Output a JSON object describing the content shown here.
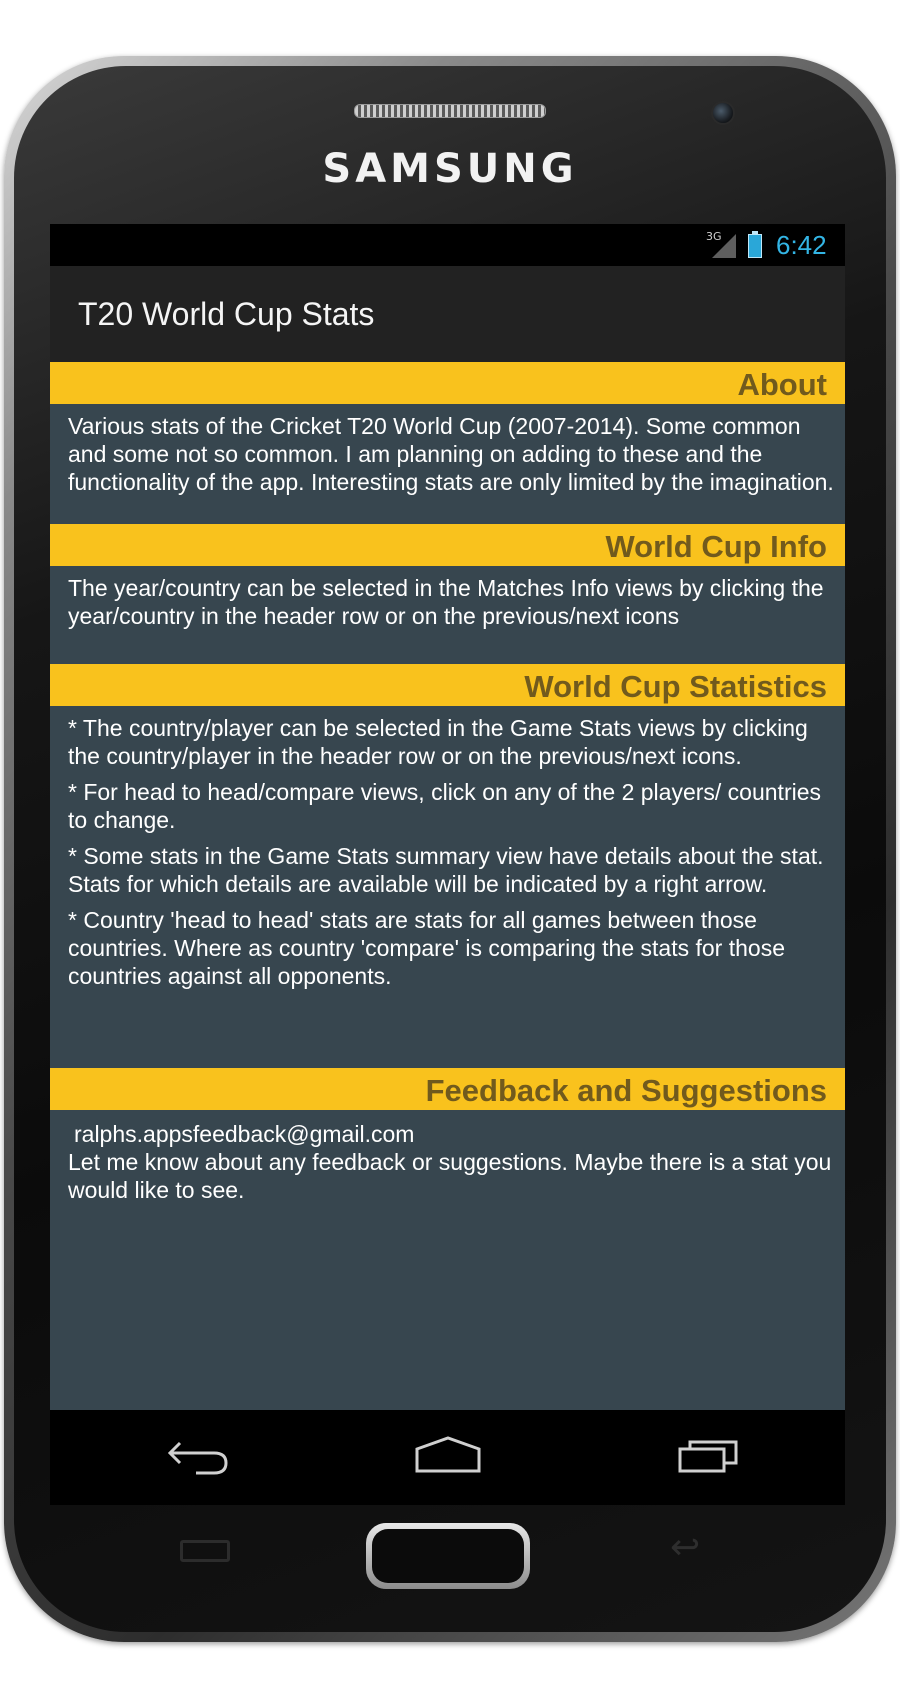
{
  "device": {
    "brand": "SAMSUNG"
  },
  "status_bar": {
    "network": "3G",
    "time": "6:42",
    "time_color": "#33b5e5"
  },
  "action_bar": {
    "title": "T20 World Cup Stats"
  },
  "colors": {
    "header_bg": "#f9c21d",
    "header_text": "#715a1d",
    "content_bg": "#37464f"
  },
  "sections": {
    "about": {
      "heading": "About",
      "body": "Various stats of the Cricket T20 World Cup (2007-2014). Some common and some not so common. I am planning on adding to these and the functionality of the app. Interesting stats are only limited by the imagination."
    },
    "world_cup_info": {
      "heading": "World Cup Info",
      "body": "The year/country can be selected in the Matches Info views by clicking the year/country in the header row or on the previous/next icons"
    },
    "world_cup_statistics": {
      "heading": "World Cup Statistics",
      "items": [
        "* The country/player can be selected in the Game Stats views by clicking the country/player in the header row or on the previous/next icons.",
        "* For head to head/compare views, click on any of the 2 players/ countries to change.",
        " * Some stats in the Game Stats summary view have details about the stat. Stats for which details are available will be indicated by a right arrow.",
        " * Country 'head to head' stats are stats for all games between those countries. Where as country 'compare' is comparing the stats for those countries against all opponents."
      ]
    },
    "feedback": {
      "heading": "Feedback and Suggestions",
      "email": "ralphs.appsfeedback@gmail.com",
      "body": " Let me know about any feedback or suggestions. Maybe there is a stat you would like to see."
    }
  },
  "nav_bar": {
    "back_icon": "back-arrow-icon",
    "home_icon": "home-icon",
    "recent_icon": "recent-apps-icon"
  }
}
